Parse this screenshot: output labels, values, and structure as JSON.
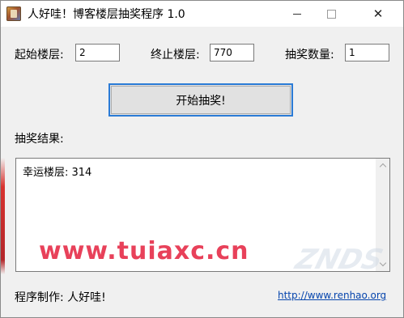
{
  "window": {
    "title": "人好哇！博客楼层抽奖程序 1.0",
    "close_glyph": "✕"
  },
  "form": {
    "start_floor_label": "起始楼层:",
    "start_floor_value": "2",
    "end_floor_label": "终止楼层:",
    "end_floor_value": "770",
    "draw_count_label": "抽奖数量:",
    "draw_count_value": "1",
    "start_button_label": "开始抽奖!"
  },
  "results": {
    "label": "抽奖结果:",
    "text": "幸运楼层: 314"
  },
  "footer": {
    "author_label": "程序制作: 人好哇!",
    "link_text": "http://www.renhao.org"
  },
  "overlay": {
    "watermark_text": "www.tuiaxc.cn",
    "logo_text": "ZNDS"
  },
  "colors": {
    "window_bg": "#f0f0f0",
    "button_focus_border": "#2b7bd6",
    "link": "#0645ad",
    "watermark": "#e8415a"
  }
}
